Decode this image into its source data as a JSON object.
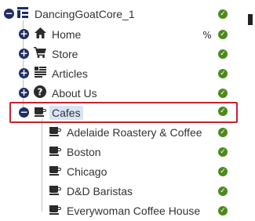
{
  "tree": {
    "root": {
      "label": "DancingGoatCore_1",
      "icon": "site-tree-icon",
      "toggle": "−"
    },
    "items": [
      {
        "label": "Home",
        "icon": "home-icon",
        "toggle": "+"
      },
      {
        "label": "Store",
        "icon": "cart-icon",
        "toggle": "+"
      },
      {
        "label": "Articles",
        "icon": "articles-icon",
        "toggle": "+"
      },
      {
        "label": "About Us",
        "icon": "question-icon",
        "toggle": "+"
      },
      {
        "label": "Cafes",
        "icon": "coffee-cup-icon",
        "toggle": "−",
        "selected": true
      }
    ],
    "children": [
      {
        "label": "Adelaide Roastery & Coffee",
        "icon": "coffee-cup-icon"
      },
      {
        "label": "Boston",
        "icon": "coffee-cup-icon"
      },
      {
        "label": "Chicago",
        "icon": "coffee-cup-icon"
      },
      {
        "label": "D&D Baristas",
        "icon": "coffee-cup-icon"
      },
      {
        "label": "Everywoman Coffee House",
        "icon": "coffee-cup-icon"
      }
    ],
    "status_icon": "published-check-icon",
    "status_color": "#4d8a1d",
    "highlight_color": "#c2252d"
  }
}
